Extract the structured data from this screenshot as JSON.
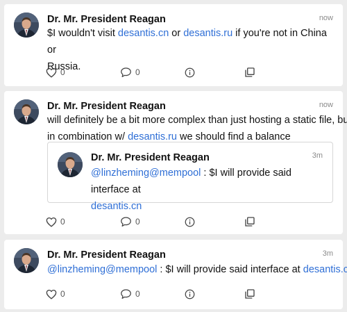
{
  "posts": [
    {
      "author": "Dr. Mr. President Reagan",
      "time": "now",
      "line1": {
        "t1": "$I wouldn't visit ",
        "link1": "desantis.cn",
        "t2": " or ",
        "link2": "desantis.ru",
        "t3": " if you're not in China or"
      },
      "line2": "Russia.",
      "likes": "0",
      "replies": "0"
    },
    {
      "author": "Dr. Mr. President Reagan",
      "time": "now",
      "line1": "will definitely be a bit more complex than just hosting a static file, but",
      "line2": {
        "t1": "in combination w/ ",
        "link1": "desantis.ru",
        "t2": " we should find a balance"
      },
      "quote": {
        "author": "Dr. Mr. President Reagan",
        "time": "3m",
        "mention": "@linzheming@mempool",
        "text": " : $I will provide said interface at",
        "link": "desantis.cn"
      },
      "likes": "0",
      "replies": "0"
    },
    {
      "author": "Dr. Mr. President Reagan",
      "time": "3m",
      "mention": "@linzheming@mempool",
      "text": " : $I will provide said interface at ",
      "link": "desantis.cn",
      "likes": "0",
      "replies": "0"
    }
  ],
  "icons": {
    "like": "heart-icon",
    "reply": "comment-icon",
    "info": "info-icon",
    "repost": "copy-icon"
  },
  "colors": {
    "link": "#2f6fd6",
    "background": "#ececec",
    "card": "#ffffff",
    "muted": "#8a8a8a"
  }
}
